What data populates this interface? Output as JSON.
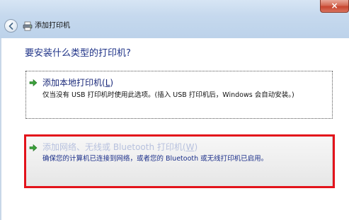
{
  "window": {
    "title": "添加打印机",
    "close_glyph": "×",
    "back_icon": "back-arrow-icon",
    "title_icon": "printer-icon"
  },
  "question": "要安装什么类型的打印机?",
  "options": [
    {
      "title_main": "添加本地打印机(",
      "title_key": "L",
      "title_end": ")",
      "description": "仅当没有 USB 打印机时使用此选项。(插入 USB 打印机后，Windows 会自动安装。)",
      "icon": "green-arrow-icon"
    },
    {
      "title_main": "添加网络、无线或 Bluetooth 打印机(",
      "title_key": "W",
      "title_end": ")",
      "description": "确保您的计算机已连接到网络，或者您的 Bluetooth 或无线打印机已启用。",
      "icon": "green-arrow-icon"
    }
  ],
  "colors": {
    "highlight": "#e3131b",
    "heading": "#1e3287",
    "link_text": "#1b2a7a",
    "selected_desc": "#1b2f8a"
  }
}
